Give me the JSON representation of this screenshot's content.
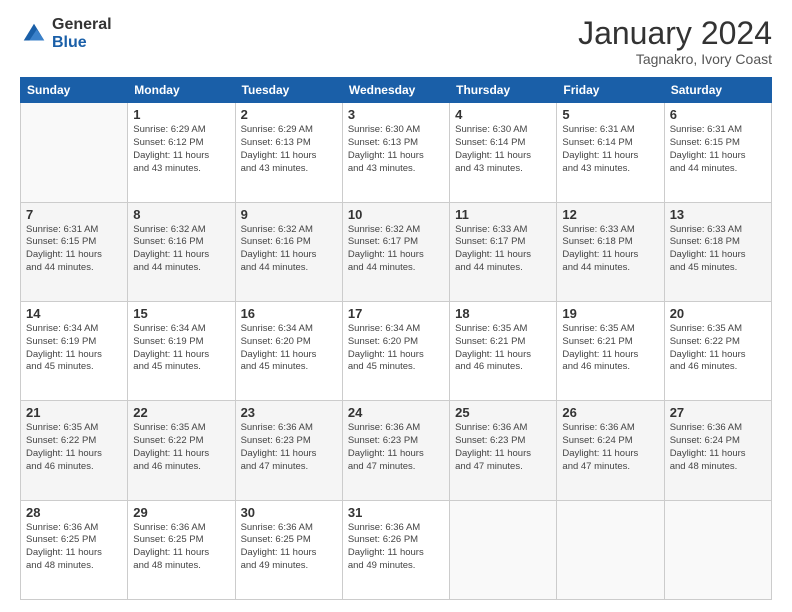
{
  "logo": {
    "general": "General",
    "blue": "Blue"
  },
  "title": "January 2024",
  "subtitle": "Tagnakro, Ivory Coast",
  "days_header": [
    "Sunday",
    "Monday",
    "Tuesday",
    "Wednesday",
    "Thursday",
    "Friday",
    "Saturday"
  ],
  "weeks": [
    [
      {
        "num": "",
        "info": ""
      },
      {
        "num": "1",
        "info": "Sunrise: 6:29 AM\nSunset: 6:12 PM\nDaylight: 11 hours\nand 43 minutes."
      },
      {
        "num": "2",
        "info": "Sunrise: 6:29 AM\nSunset: 6:13 PM\nDaylight: 11 hours\nand 43 minutes."
      },
      {
        "num": "3",
        "info": "Sunrise: 6:30 AM\nSunset: 6:13 PM\nDaylight: 11 hours\nand 43 minutes."
      },
      {
        "num": "4",
        "info": "Sunrise: 6:30 AM\nSunset: 6:14 PM\nDaylight: 11 hours\nand 43 minutes."
      },
      {
        "num": "5",
        "info": "Sunrise: 6:31 AM\nSunset: 6:14 PM\nDaylight: 11 hours\nand 43 minutes."
      },
      {
        "num": "6",
        "info": "Sunrise: 6:31 AM\nSunset: 6:15 PM\nDaylight: 11 hours\nand 44 minutes."
      }
    ],
    [
      {
        "num": "7",
        "info": "Sunrise: 6:31 AM\nSunset: 6:15 PM\nDaylight: 11 hours\nand 44 minutes."
      },
      {
        "num": "8",
        "info": "Sunrise: 6:32 AM\nSunset: 6:16 PM\nDaylight: 11 hours\nand 44 minutes."
      },
      {
        "num": "9",
        "info": "Sunrise: 6:32 AM\nSunset: 6:16 PM\nDaylight: 11 hours\nand 44 minutes."
      },
      {
        "num": "10",
        "info": "Sunrise: 6:32 AM\nSunset: 6:17 PM\nDaylight: 11 hours\nand 44 minutes."
      },
      {
        "num": "11",
        "info": "Sunrise: 6:33 AM\nSunset: 6:17 PM\nDaylight: 11 hours\nand 44 minutes."
      },
      {
        "num": "12",
        "info": "Sunrise: 6:33 AM\nSunset: 6:18 PM\nDaylight: 11 hours\nand 44 minutes."
      },
      {
        "num": "13",
        "info": "Sunrise: 6:33 AM\nSunset: 6:18 PM\nDaylight: 11 hours\nand 45 minutes."
      }
    ],
    [
      {
        "num": "14",
        "info": "Sunrise: 6:34 AM\nSunset: 6:19 PM\nDaylight: 11 hours\nand 45 minutes."
      },
      {
        "num": "15",
        "info": "Sunrise: 6:34 AM\nSunset: 6:19 PM\nDaylight: 11 hours\nand 45 minutes."
      },
      {
        "num": "16",
        "info": "Sunrise: 6:34 AM\nSunset: 6:20 PM\nDaylight: 11 hours\nand 45 minutes."
      },
      {
        "num": "17",
        "info": "Sunrise: 6:34 AM\nSunset: 6:20 PM\nDaylight: 11 hours\nand 45 minutes."
      },
      {
        "num": "18",
        "info": "Sunrise: 6:35 AM\nSunset: 6:21 PM\nDaylight: 11 hours\nand 46 minutes."
      },
      {
        "num": "19",
        "info": "Sunrise: 6:35 AM\nSunset: 6:21 PM\nDaylight: 11 hours\nand 46 minutes."
      },
      {
        "num": "20",
        "info": "Sunrise: 6:35 AM\nSunset: 6:22 PM\nDaylight: 11 hours\nand 46 minutes."
      }
    ],
    [
      {
        "num": "21",
        "info": "Sunrise: 6:35 AM\nSunset: 6:22 PM\nDaylight: 11 hours\nand 46 minutes."
      },
      {
        "num": "22",
        "info": "Sunrise: 6:35 AM\nSunset: 6:22 PM\nDaylight: 11 hours\nand 46 minutes."
      },
      {
        "num": "23",
        "info": "Sunrise: 6:36 AM\nSunset: 6:23 PM\nDaylight: 11 hours\nand 47 minutes."
      },
      {
        "num": "24",
        "info": "Sunrise: 6:36 AM\nSunset: 6:23 PM\nDaylight: 11 hours\nand 47 minutes."
      },
      {
        "num": "25",
        "info": "Sunrise: 6:36 AM\nSunset: 6:23 PM\nDaylight: 11 hours\nand 47 minutes."
      },
      {
        "num": "26",
        "info": "Sunrise: 6:36 AM\nSunset: 6:24 PM\nDaylight: 11 hours\nand 47 minutes."
      },
      {
        "num": "27",
        "info": "Sunrise: 6:36 AM\nSunset: 6:24 PM\nDaylight: 11 hours\nand 48 minutes."
      }
    ],
    [
      {
        "num": "28",
        "info": "Sunrise: 6:36 AM\nSunset: 6:25 PM\nDaylight: 11 hours\nand 48 minutes."
      },
      {
        "num": "29",
        "info": "Sunrise: 6:36 AM\nSunset: 6:25 PM\nDaylight: 11 hours\nand 48 minutes."
      },
      {
        "num": "30",
        "info": "Sunrise: 6:36 AM\nSunset: 6:25 PM\nDaylight: 11 hours\nand 49 minutes."
      },
      {
        "num": "31",
        "info": "Sunrise: 6:36 AM\nSunset: 6:26 PM\nDaylight: 11 hours\nand 49 minutes."
      },
      {
        "num": "",
        "info": ""
      },
      {
        "num": "",
        "info": ""
      },
      {
        "num": "",
        "info": ""
      }
    ]
  ]
}
